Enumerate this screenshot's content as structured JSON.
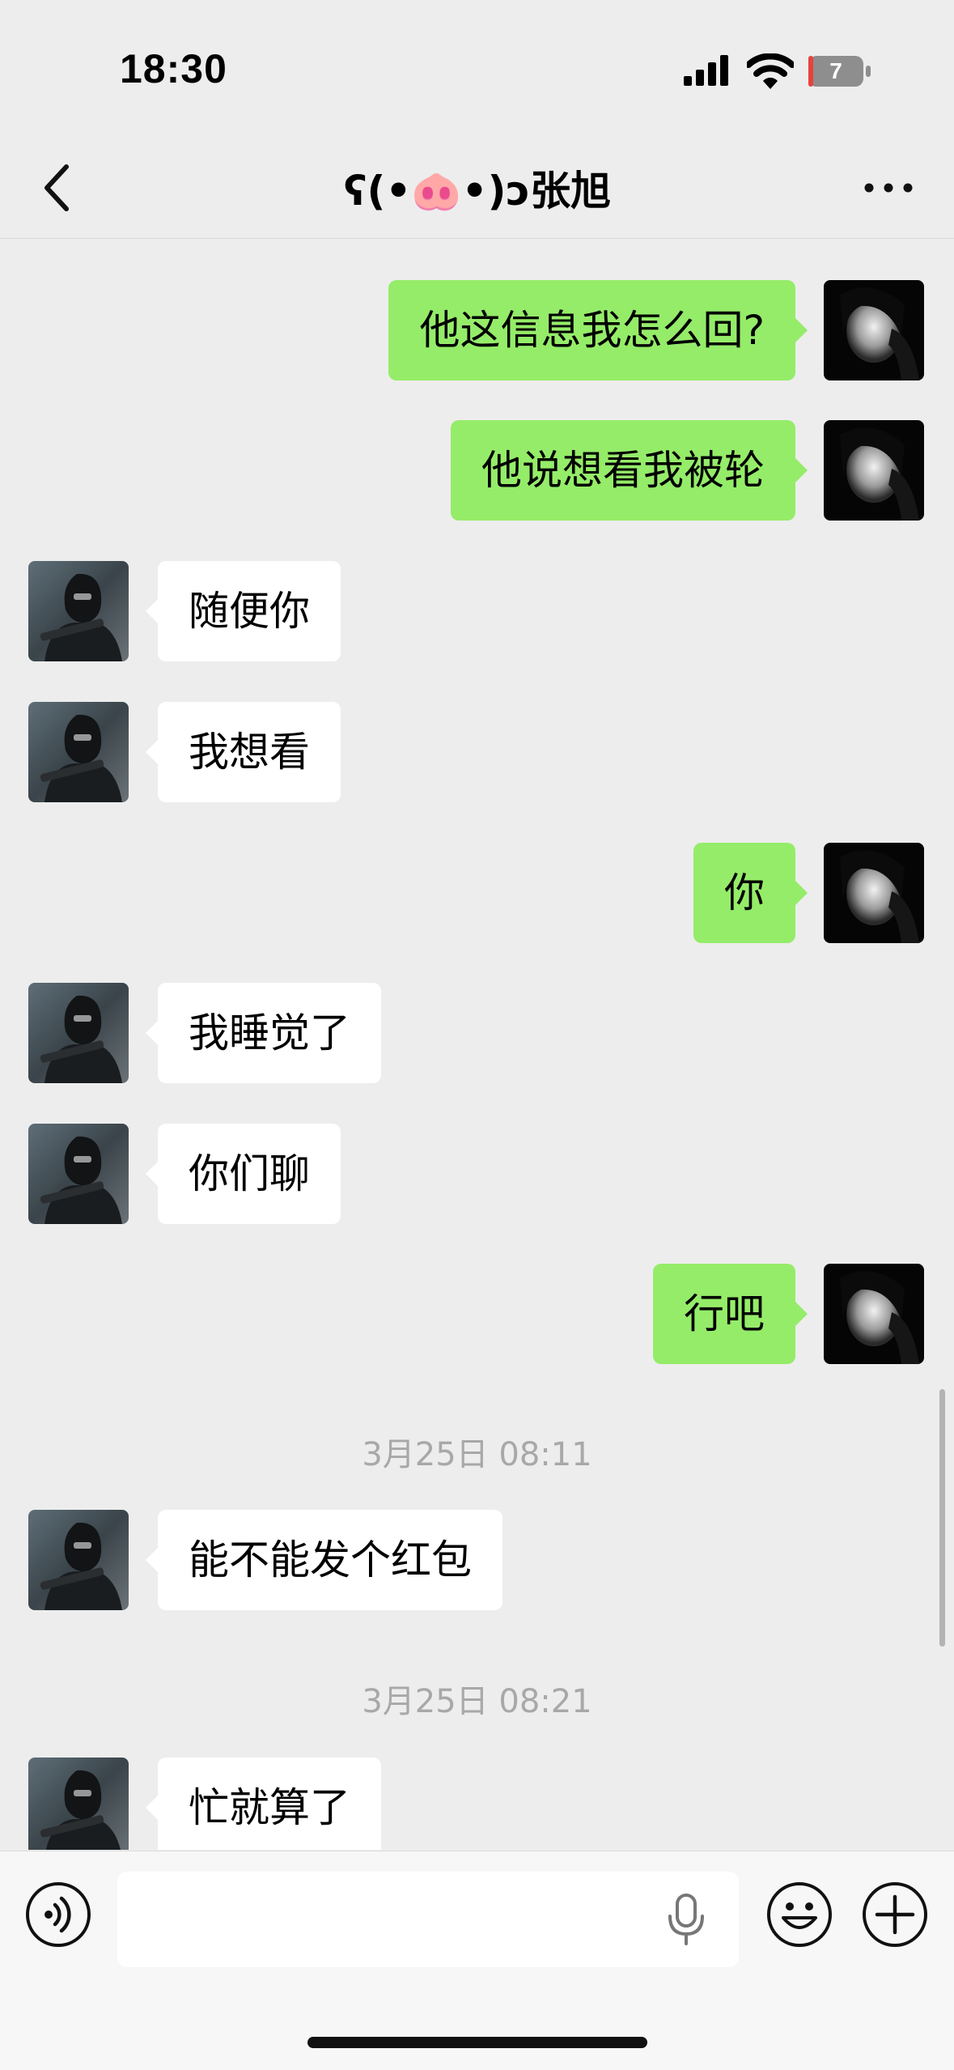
{
  "status_bar": {
    "time": "18:30",
    "battery_level": "7",
    "battery_color": "#e8413c"
  },
  "header": {
    "title": "ʕ(•🐽•)ɔ张旭",
    "back_icon": "chevron-left-icon",
    "more_icon": "ellipsis-icon"
  },
  "messages": [
    {
      "direction": "out",
      "text": "他这信息我怎么回?"
    },
    {
      "direction": "out",
      "text": "他说想看我被轮"
    },
    {
      "direction": "in",
      "text": "随便你"
    },
    {
      "direction": "in",
      "text": "我想看"
    },
    {
      "direction": "out",
      "text": "你"
    },
    {
      "direction": "in",
      "text": "我睡觉了"
    },
    {
      "direction": "in",
      "text": "你们聊"
    },
    {
      "direction": "out",
      "text": "行吧"
    },
    {
      "type": "timestamp",
      "text": "3月25日 08:11"
    },
    {
      "direction": "in",
      "text": "能不能发个红包"
    },
    {
      "type": "timestamp",
      "text": "3月25日 08:21"
    },
    {
      "direction": "in",
      "text": "忙就算了"
    }
  ],
  "input_bar": {
    "value": "",
    "icons": [
      "voice-icon",
      "microphone-icon",
      "emoji-icon",
      "plus-icon"
    ]
  },
  "colors": {
    "background": "#ededed",
    "incoming_bubble": "#ffffff",
    "outgoing_bubble": "#95ec69",
    "timestamp_text": "#a8a8a8"
  }
}
